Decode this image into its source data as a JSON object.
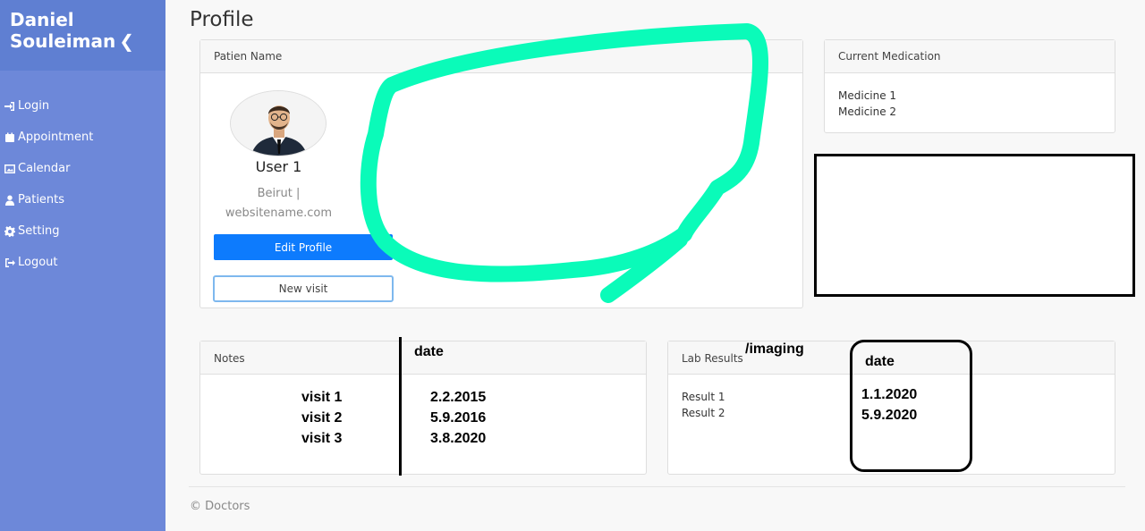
{
  "sidebar": {
    "brand_line1": "Daniel",
    "brand_line2": "Souleiman",
    "items": [
      {
        "label": "Login",
        "icon": "sign-in-icon"
      },
      {
        "label": "Appointment",
        "icon": "calendar-icon"
      },
      {
        "label": "Calendar",
        "icon": "image-icon"
      },
      {
        "label": "Patients",
        "icon": "user-icon"
      },
      {
        "label": "Setting",
        "icon": "gear-icon"
      },
      {
        "label": "Logout",
        "icon": "sign-out-icon"
      }
    ]
  },
  "page": {
    "title": "Profile"
  },
  "profile": {
    "header": "Patien Name",
    "user_name": "User 1",
    "location": "Beirut |",
    "website": "websitename.com",
    "edit_label": "Edit Profile",
    "new_visit_label": "New visit"
  },
  "medication": {
    "header": "Current Medication",
    "items": [
      "Medicine 1",
      "Medicine 2"
    ]
  },
  "notes": {
    "header": "Notes",
    "date_label": "date",
    "visits": [
      "visit 1",
      "visit 2",
      "visit 3"
    ],
    "dates": [
      "2.2.2015",
      "5.9.2016",
      "3.8.2020"
    ]
  },
  "lab": {
    "header": "Lab Results",
    "imaging_label": "/imaging",
    "date_label": "date",
    "results": [
      "Result 1",
      "Result 2"
    ],
    "dates": [
      "1.1.2020",
      "5.9.2020"
    ]
  },
  "footer": {
    "text": "© Doctors"
  },
  "colors": {
    "sidebar": "#6d88d9",
    "brand": "#5f7fd2",
    "primary_button": "#0d7bfd",
    "highlight_scribble": "#0afbb9"
  }
}
